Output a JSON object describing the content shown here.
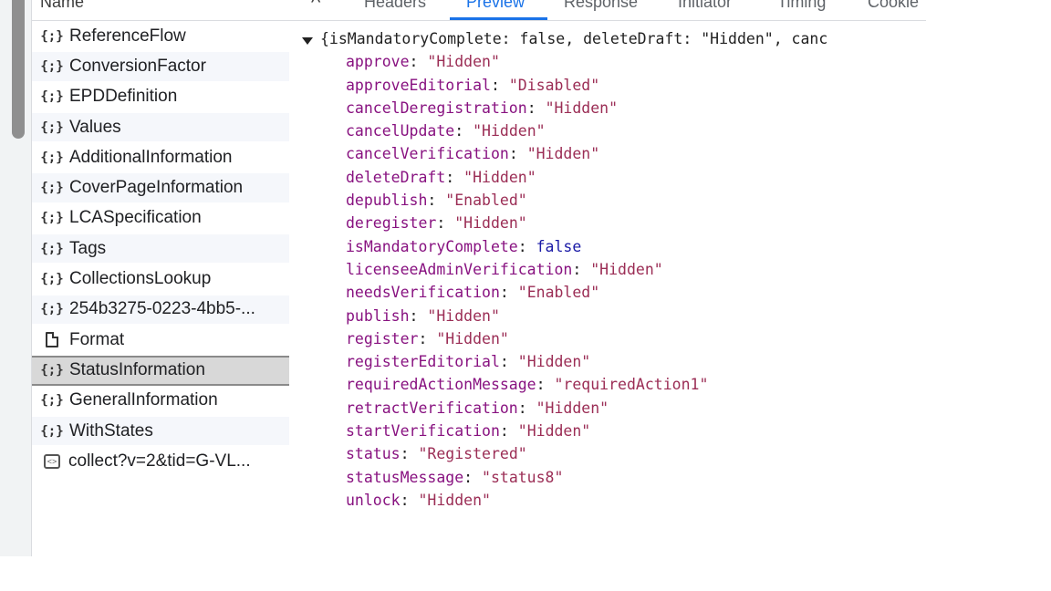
{
  "request_list": {
    "header_label": "Name",
    "items": [
      {
        "icon": "json-braces-icon",
        "name": "ReferenceFlow"
      },
      {
        "icon": "json-braces-icon",
        "name": "ConversionFactor"
      },
      {
        "icon": "json-braces-icon",
        "name": "EPDDefinition"
      },
      {
        "icon": "json-braces-icon",
        "name": "Values"
      },
      {
        "icon": "json-braces-icon",
        "name": "AdditionalInformation"
      },
      {
        "icon": "json-braces-icon",
        "name": "CoverPageInformation"
      },
      {
        "icon": "json-braces-icon",
        "name": "LCASpecification"
      },
      {
        "icon": "json-braces-icon",
        "name": "Tags"
      },
      {
        "icon": "json-braces-icon",
        "name": "CollectionsLookup"
      },
      {
        "icon": "json-braces-icon",
        "name": "254b3275-0223-4bb5-..."
      },
      {
        "icon": "document-icon",
        "name": "Format"
      },
      {
        "icon": "json-braces-icon",
        "name": "StatusInformation",
        "selected": true
      },
      {
        "icon": "json-braces-icon",
        "name": "GeneralInformation"
      },
      {
        "icon": "json-braces-icon",
        "name": "WithStates"
      },
      {
        "icon": "script-icon",
        "name": "collect?v=2&tid=G-VL..."
      }
    ]
  },
  "detail_tabs": {
    "close_glyph": "^",
    "tabs": [
      "Headers",
      "Preview",
      "Response",
      "Initiator",
      "Timing",
      "Cookie"
    ],
    "active": "Preview"
  },
  "preview": {
    "summary": "{isMandatoryComplete: false, deleteDraft: \"Hidden\", canc",
    "properties": [
      {
        "key": "approve",
        "value": "\"Hidden\"",
        "type": "string"
      },
      {
        "key": "approveEditorial",
        "value": "\"Disabled\"",
        "type": "string"
      },
      {
        "key": "cancelDeregistration",
        "value": "\"Hidden\"",
        "type": "string"
      },
      {
        "key": "cancelUpdate",
        "value": "\"Hidden\"",
        "type": "string"
      },
      {
        "key": "cancelVerification",
        "value": "\"Hidden\"",
        "type": "string"
      },
      {
        "key": "deleteDraft",
        "value": "\"Hidden\"",
        "type": "string"
      },
      {
        "key": "depublish",
        "value": "\"Enabled\"",
        "type": "string"
      },
      {
        "key": "deregister",
        "value": "\"Hidden\"",
        "type": "string"
      },
      {
        "key": "isMandatoryComplete",
        "value": "false",
        "type": "boolean"
      },
      {
        "key": "licenseeAdminVerification",
        "value": "\"Hidden\"",
        "type": "string"
      },
      {
        "key": "needsVerification",
        "value": "\"Enabled\"",
        "type": "string"
      },
      {
        "key": "publish",
        "value": "\"Hidden\"",
        "type": "string"
      },
      {
        "key": "register",
        "value": "\"Hidden\"",
        "type": "string"
      },
      {
        "key": "registerEditorial",
        "value": "\"Hidden\"",
        "type": "string"
      },
      {
        "key": "requiredActionMessage",
        "value": "\"requiredAction1\"",
        "type": "string"
      },
      {
        "key": "retractVerification",
        "value": "\"Hidden\"",
        "type": "string"
      },
      {
        "key": "startVerification",
        "value": "\"Hidden\"",
        "type": "string"
      },
      {
        "key": "status",
        "value": "\"Registered\"",
        "type": "string"
      },
      {
        "key": "statusMessage",
        "value": "\"status8\"",
        "type": "string"
      },
      {
        "key": "unlock",
        "value": "\"Hidden\"",
        "type": "string"
      }
    ]
  },
  "colors": {
    "accent": "#1a73e8",
    "json_key": "#881280",
    "json_string": "#9b2d55",
    "json_boolean": "#1a1aa6",
    "selected_row": "#d8d8d8"
  }
}
